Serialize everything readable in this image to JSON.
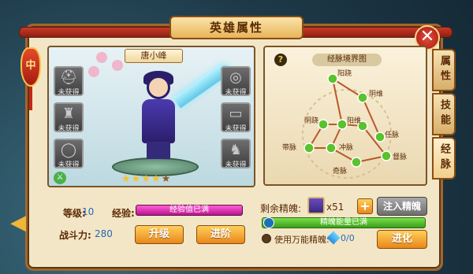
{
  "title": "英雄属性",
  "close_icon": "close-icon",
  "ornament_text": "中",
  "hero": {
    "name": "唐小峰",
    "stars_total": 5,
    "stars_filled": 4,
    "level_badge": "⚔",
    "equip_status": "未获得",
    "equip_slots_left": [
      "helmet-icon",
      "armor-icon",
      "necklace-icon"
    ],
    "equip_slots_right": [
      "ring-icon",
      "belt-icon",
      "boots-icon"
    ]
  },
  "stats": {
    "level_label": "等级:",
    "level_value": "10",
    "exp_label": "经验:",
    "exp_bar_text": "经验值已满",
    "exp_progress": 1.0,
    "power_label": "战斗力:",
    "power_value": "280"
  },
  "buttons": {
    "upgrade": "升级",
    "advance_left": "进阶",
    "inject": "注入精魄",
    "advance_right": "进化"
  },
  "meridian": {
    "title": "经脉境界图",
    "help": "?",
    "nodes": [
      "阳跷",
      "阴维",
      "阴跷",
      "阳维",
      "冲脉",
      "任脉",
      "带脉",
      "督脉",
      "奇脉"
    ]
  },
  "side_tabs": [
    "属性",
    "技能",
    "经脉"
  ],
  "active_tab": "经脉",
  "essence": {
    "label": "剩余精魄:",
    "count": "x51",
    "bar_text": "精魄能量已满",
    "bar_progress": 1.0,
    "use_universal_label": "使用万能精魄:",
    "universal_count": "0/0"
  },
  "colors": {
    "accent": "#c83a26",
    "exp_bar": "#e64ac0",
    "essence_bar": "#5ac22a",
    "button_orange": "#f2a33a"
  }
}
